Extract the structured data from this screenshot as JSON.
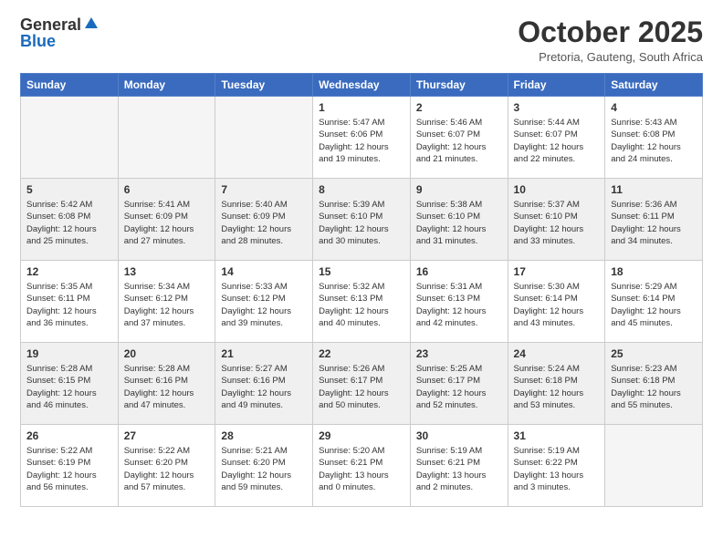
{
  "header": {
    "logo_line1": "General",
    "logo_line2": "Blue",
    "title": "October 2025",
    "subtitle": "Pretoria, Gauteng, South Africa"
  },
  "weekdays": [
    "Sunday",
    "Monday",
    "Tuesday",
    "Wednesday",
    "Thursday",
    "Friday",
    "Saturday"
  ],
  "weeks": [
    {
      "shaded": false,
      "days": [
        {
          "num": "",
          "info": ""
        },
        {
          "num": "",
          "info": ""
        },
        {
          "num": "",
          "info": ""
        },
        {
          "num": "1",
          "info": "Sunrise: 5:47 AM\nSunset: 6:06 PM\nDaylight: 12 hours\nand 19 minutes."
        },
        {
          "num": "2",
          "info": "Sunrise: 5:46 AM\nSunset: 6:07 PM\nDaylight: 12 hours\nand 21 minutes."
        },
        {
          "num": "3",
          "info": "Sunrise: 5:44 AM\nSunset: 6:07 PM\nDaylight: 12 hours\nand 22 minutes."
        },
        {
          "num": "4",
          "info": "Sunrise: 5:43 AM\nSunset: 6:08 PM\nDaylight: 12 hours\nand 24 minutes."
        }
      ]
    },
    {
      "shaded": true,
      "days": [
        {
          "num": "5",
          "info": "Sunrise: 5:42 AM\nSunset: 6:08 PM\nDaylight: 12 hours\nand 25 minutes."
        },
        {
          "num": "6",
          "info": "Sunrise: 5:41 AM\nSunset: 6:09 PM\nDaylight: 12 hours\nand 27 minutes."
        },
        {
          "num": "7",
          "info": "Sunrise: 5:40 AM\nSunset: 6:09 PM\nDaylight: 12 hours\nand 28 minutes."
        },
        {
          "num": "8",
          "info": "Sunrise: 5:39 AM\nSunset: 6:10 PM\nDaylight: 12 hours\nand 30 minutes."
        },
        {
          "num": "9",
          "info": "Sunrise: 5:38 AM\nSunset: 6:10 PM\nDaylight: 12 hours\nand 31 minutes."
        },
        {
          "num": "10",
          "info": "Sunrise: 5:37 AM\nSunset: 6:10 PM\nDaylight: 12 hours\nand 33 minutes."
        },
        {
          "num": "11",
          "info": "Sunrise: 5:36 AM\nSunset: 6:11 PM\nDaylight: 12 hours\nand 34 minutes."
        }
      ]
    },
    {
      "shaded": false,
      "days": [
        {
          "num": "12",
          "info": "Sunrise: 5:35 AM\nSunset: 6:11 PM\nDaylight: 12 hours\nand 36 minutes."
        },
        {
          "num": "13",
          "info": "Sunrise: 5:34 AM\nSunset: 6:12 PM\nDaylight: 12 hours\nand 37 minutes."
        },
        {
          "num": "14",
          "info": "Sunrise: 5:33 AM\nSunset: 6:12 PM\nDaylight: 12 hours\nand 39 minutes."
        },
        {
          "num": "15",
          "info": "Sunrise: 5:32 AM\nSunset: 6:13 PM\nDaylight: 12 hours\nand 40 minutes."
        },
        {
          "num": "16",
          "info": "Sunrise: 5:31 AM\nSunset: 6:13 PM\nDaylight: 12 hours\nand 42 minutes."
        },
        {
          "num": "17",
          "info": "Sunrise: 5:30 AM\nSunset: 6:14 PM\nDaylight: 12 hours\nand 43 minutes."
        },
        {
          "num": "18",
          "info": "Sunrise: 5:29 AM\nSunset: 6:14 PM\nDaylight: 12 hours\nand 45 minutes."
        }
      ]
    },
    {
      "shaded": true,
      "days": [
        {
          "num": "19",
          "info": "Sunrise: 5:28 AM\nSunset: 6:15 PM\nDaylight: 12 hours\nand 46 minutes."
        },
        {
          "num": "20",
          "info": "Sunrise: 5:28 AM\nSunset: 6:16 PM\nDaylight: 12 hours\nand 47 minutes."
        },
        {
          "num": "21",
          "info": "Sunrise: 5:27 AM\nSunset: 6:16 PM\nDaylight: 12 hours\nand 49 minutes."
        },
        {
          "num": "22",
          "info": "Sunrise: 5:26 AM\nSunset: 6:17 PM\nDaylight: 12 hours\nand 50 minutes."
        },
        {
          "num": "23",
          "info": "Sunrise: 5:25 AM\nSunset: 6:17 PM\nDaylight: 12 hours\nand 52 minutes."
        },
        {
          "num": "24",
          "info": "Sunrise: 5:24 AM\nSunset: 6:18 PM\nDaylight: 12 hours\nand 53 minutes."
        },
        {
          "num": "25",
          "info": "Sunrise: 5:23 AM\nSunset: 6:18 PM\nDaylight: 12 hours\nand 55 minutes."
        }
      ]
    },
    {
      "shaded": false,
      "days": [
        {
          "num": "26",
          "info": "Sunrise: 5:22 AM\nSunset: 6:19 PM\nDaylight: 12 hours\nand 56 minutes."
        },
        {
          "num": "27",
          "info": "Sunrise: 5:22 AM\nSunset: 6:20 PM\nDaylight: 12 hours\nand 57 minutes."
        },
        {
          "num": "28",
          "info": "Sunrise: 5:21 AM\nSunset: 6:20 PM\nDaylight: 12 hours\nand 59 minutes."
        },
        {
          "num": "29",
          "info": "Sunrise: 5:20 AM\nSunset: 6:21 PM\nDaylight: 13 hours\nand 0 minutes."
        },
        {
          "num": "30",
          "info": "Sunrise: 5:19 AM\nSunset: 6:21 PM\nDaylight: 13 hours\nand 2 minutes."
        },
        {
          "num": "31",
          "info": "Sunrise: 5:19 AM\nSunset: 6:22 PM\nDaylight: 13 hours\nand 3 minutes."
        },
        {
          "num": "",
          "info": ""
        }
      ]
    }
  ]
}
